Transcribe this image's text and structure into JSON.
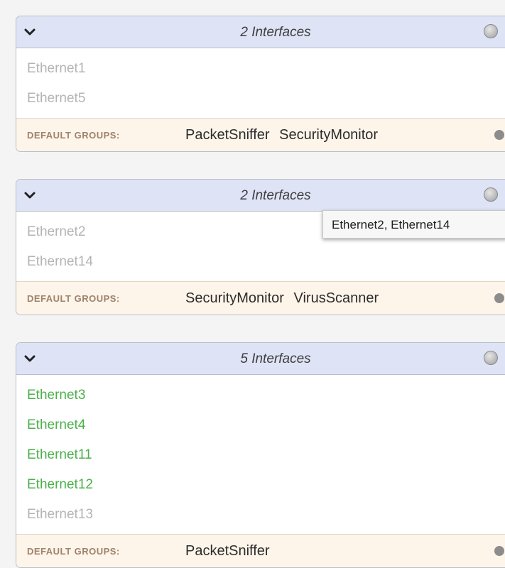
{
  "groups": [
    {
      "title": "2 Interfaces",
      "interfaces": [
        {
          "name": "Ethernet1",
          "active": false
        },
        {
          "name": "Ethernet5",
          "active": false
        }
      ],
      "defaults_label": "DEFAULT GROUPS:",
      "defaults": [
        "PacketSniffer",
        "SecurityMonitor"
      ]
    },
    {
      "title": "2 Interfaces",
      "interfaces": [
        {
          "name": "Ethernet2",
          "active": false
        },
        {
          "name": "Ethernet14",
          "active": false
        }
      ],
      "defaults_label": "DEFAULT GROUPS:",
      "defaults": [
        "SecurityMonitor",
        "VirusScanner"
      ]
    },
    {
      "title": "5 Interfaces",
      "interfaces": [
        {
          "name": "Ethernet3",
          "active": true
        },
        {
          "name": "Ethernet4",
          "active": true
        },
        {
          "name": "Ethernet11",
          "active": true
        },
        {
          "name": "Ethernet12",
          "active": true
        },
        {
          "name": "Ethernet13",
          "active": false
        }
      ],
      "defaults_label": "DEFAULT GROUPS:",
      "defaults": [
        "PacketSniffer"
      ]
    }
  ],
  "tooltip": {
    "text": "Ethernet2, Ethernet14"
  },
  "colors": {
    "header_bg": "#dfe3f6",
    "defaults_bg": "#fdf4ea",
    "active_interface": "#4bb04b",
    "inactive_interface": "#b4b4b4",
    "defaults_label": "#a0826a"
  },
  "icons": {
    "collapse": "chevron-down-icon",
    "status": "status-dot-icon"
  }
}
